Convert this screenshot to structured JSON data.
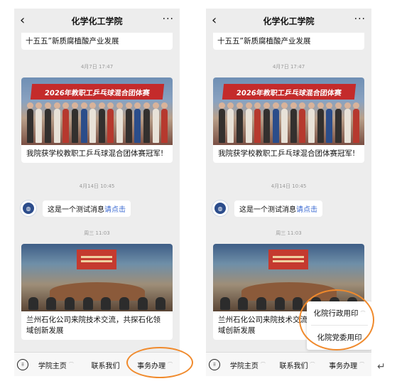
{
  "header": {
    "back": "‹",
    "title": "化学化工学院",
    "more": "···"
  },
  "messages": {
    "partial_title": "十五五”新质腐植酸产业发展",
    "time1": "4月7日 17:47",
    "banner": "2026年教职工乒乓球混合团体赛",
    "article1_caption": "我院获学校教职工乒乓球混合团体赛冠军!",
    "time2": "4月14日 10:45",
    "avatar_icon": "school-logo",
    "test_text": "这是一个测试消息",
    "test_link": "请点击",
    "time3": "周三 11:03",
    "article2_caption": "兰州石化公司来院技术交流，共探石化领域创新发展"
  },
  "menu": {
    "keyboard_icon": "keyboard-icon",
    "items": [
      "学院主页",
      "联系我们",
      "事务办理"
    ],
    "sep": "⌒"
  },
  "popup": {
    "items": [
      "化院行政用印",
      "化院党委用印"
    ]
  },
  "annotation": {
    "enter_mark": "↵",
    "circle_color": "#f08a2c"
  }
}
